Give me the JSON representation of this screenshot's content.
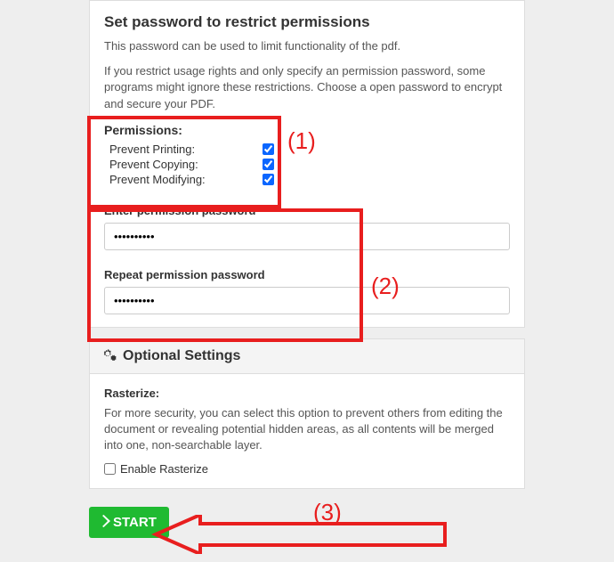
{
  "section1": {
    "title": "Set password to restrict permissions",
    "desc1": "This password can be used to limit functionality of the pdf.",
    "desc2": "If you restrict usage rights and only specify an permission password, some programs might ignore these restrictions. Choose a open password to encrypt and secure your PDF.",
    "permissionsLabel": "Permissions:",
    "perm1": "Prevent Printing:",
    "perm2": "Prevent Copying:",
    "perm3": "Prevent Modifying:",
    "enterPwLabel": "Enter permission password",
    "repeatPwLabel": "Repeat permission password",
    "pwValue1": "••••••••••",
    "pwValue2": "••••••••••"
  },
  "optional": {
    "header": "Optional Settings",
    "rasterizeLabel": "Rasterize:",
    "rasterizeDesc": "For more security, you can select this option to prevent others from editing the document or revealing potential hidden areas, as all contents will be merged into one, non-searchable layer.",
    "enableLabel": "Enable Rasterize"
  },
  "startLabel": "START",
  "annotations": {
    "a1": "(1)",
    "a2": "(2)",
    "a3": "(3)"
  }
}
